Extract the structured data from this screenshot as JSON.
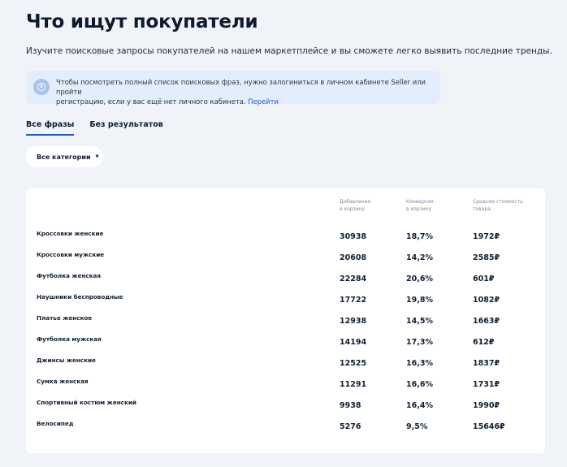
{
  "header": {
    "title": "Что ищут покупатели",
    "subtitle": "Изучите поисковые запросы покупателей на нашем маркетплейсе и вы сможете легко выявить последние тренды."
  },
  "notice": {
    "icon": "info-icon",
    "text_line1": "Чтобы посмотреть полный список поисковых фраз, нужно залогиниться в личном кабинете Seller или пройти",
    "text_line2": "регистрацию, если у вас ещё нет личного кабинета.",
    "link_label": "Перейти",
    "accent_color": "#2f5bd8"
  },
  "tabs": [
    {
      "label": "Все фразы",
      "active": true
    },
    {
      "label": "Без результатов",
      "active": false
    }
  ],
  "filter": {
    "label": "Все категории",
    "caret": "▼"
  },
  "table": {
    "columns": [
      {
        "line1": "Добавления",
        "line2": "в корзину"
      },
      {
        "line1": "Конверсия",
        "line2": "в корзину"
      },
      {
        "line1": "Средняя стоимость",
        "line2": "товара"
      }
    ],
    "rows": [
      {
        "name": "Кроссовки женские",
        "added": "30938",
        "conversion": "18,7%",
        "price": "1972₽"
      },
      {
        "name": "Кроссовки мужские",
        "added": "20608",
        "conversion": "14,2%",
        "price": "2585₽"
      },
      {
        "name": "Футболка женская",
        "added": "22284",
        "conversion": "20,6%",
        "price": "601₽"
      },
      {
        "name": "Наушники беспроводные",
        "added": "17722",
        "conversion": "19,8%",
        "price": "1082₽"
      },
      {
        "name": "Платье женское",
        "added": "12938",
        "conversion": "14,5%",
        "price": "1663₽"
      },
      {
        "name": "Футболка мужская",
        "added": "14194",
        "conversion": "17,3%",
        "price": "612₽"
      },
      {
        "name": "Джинсы женские",
        "added": "12525",
        "conversion": "16,3%",
        "price": "1837₽"
      },
      {
        "name": "Сумка женская",
        "added": "11291",
        "conversion": "16,6%",
        "price": "1731₽"
      },
      {
        "name": "Спортивный костюм женский",
        "added": "9938",
        "conversion": "16,4%",
        "price": "1990₽"
      },
      {
        "name": "Велосипед",
        "added": "5276",
        "conversion": "9,5%",
        "price": "15646₽"
      }
    ]
  }
}
